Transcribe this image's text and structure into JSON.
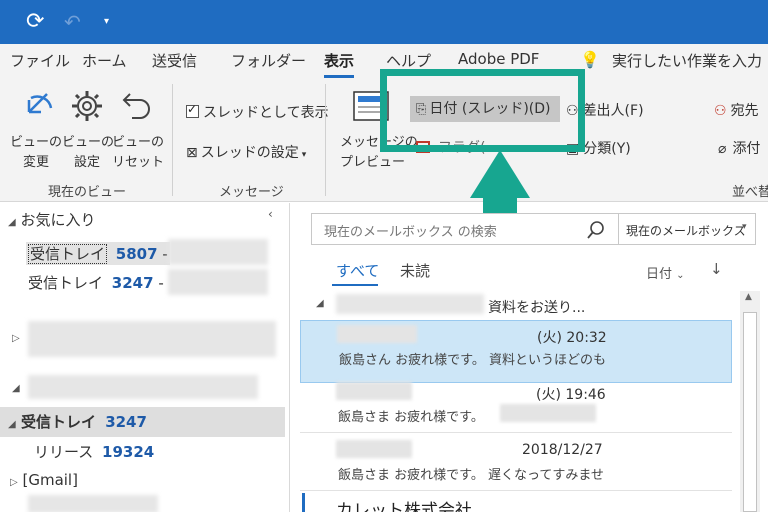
{
  "titlebar": {
    "sync_icon": "sync-icon",
    "undo_icon": "undo-icon",
    "dropdown": "▾"
  },
  "menu": {
    "tabs": [
      "ファイル",
      "ホーム",
      "送受信",
      "フォルダー",
      "表示",
      "ヘルプ",
      "Adobe PDF"
    ],
    "tell_me_placeholder": "実行したい作業を入力"
  },
  "ribbon": {
    "current_view": {
      "change_view": [
        "ビューの",
        "変更"
      ],
      "view_settings": [
        "ビューの",
        "設定"
      ],
      "reset_view": [
        "ビューの",
        "リセット"
      ],
      "group_label": "現在のビュー"
    },
    "messages": {
      "show_as_conversations": "スレッドとして表示",
      "conversation_settings": "スレッドの設定",
      "group_label": "メッセージ"
    },
    "arrangement": {
      "message_preview": [
        "メッセージの",
        "プレビュー"
      ],
      "date_conversations": "日付 (スレッド)(D)",
      "from": "差出人(F)",
      "to": "宛先",
      "categories": "分類(Y)",
      "attachments": "添付",
      "group_label": "並べ替",
      "flag_label": "フラグ(E)"
    }
  },
  "folders": {
    "favorites": "お気に入り",
    "inbox_fav_1": {
      "label": "受信トレイ",
      "count": "5807",
      "suffix": "-"
    },
    "inbox_fav_2": {
      "label": "受信トレイ",
      "count": "3247",
      "suffix": "-"
    },
    "inbox_main": {
      "label": "受信トレイ",
      "count": "3247"
    },
    "release": {
      "label": "リリース",
      "count": "19324"
    },
    "gmail": "[Gmail]"
  },
  "search": {
    "placeholder": "現在のメールボックス の検索",
    "scope": "現在のメールボックス"
  },
  "filters": {
    "all": "すべて",
    "unread": "未読",
    "sort": "日付"
  },
  "messages": {
    "thread_subject": "資料をお送り...",
    "items": [
      {
        "time": "(火) 20:32",
        "preview": "飯島さん お疲れ様です。 資料というほどのも"
      },
      {
        "time": "(火) 19:46",
        "preview": "飯島さま お疲れ様です。"
      },
      {
        "time": "2018/12/27",
        "preview": "飯島さま お疲れ様です。 遅くなってすみませ"
      }
    ],
    "next_group": "カレット株式会社"
  },
  "colors": {
    "brand": "#1f6cc1",
    "highlight": "#17a690",
    "selected_row": "#cde6f7",
    "count_blue": "#1e5aa8"
  }
}
